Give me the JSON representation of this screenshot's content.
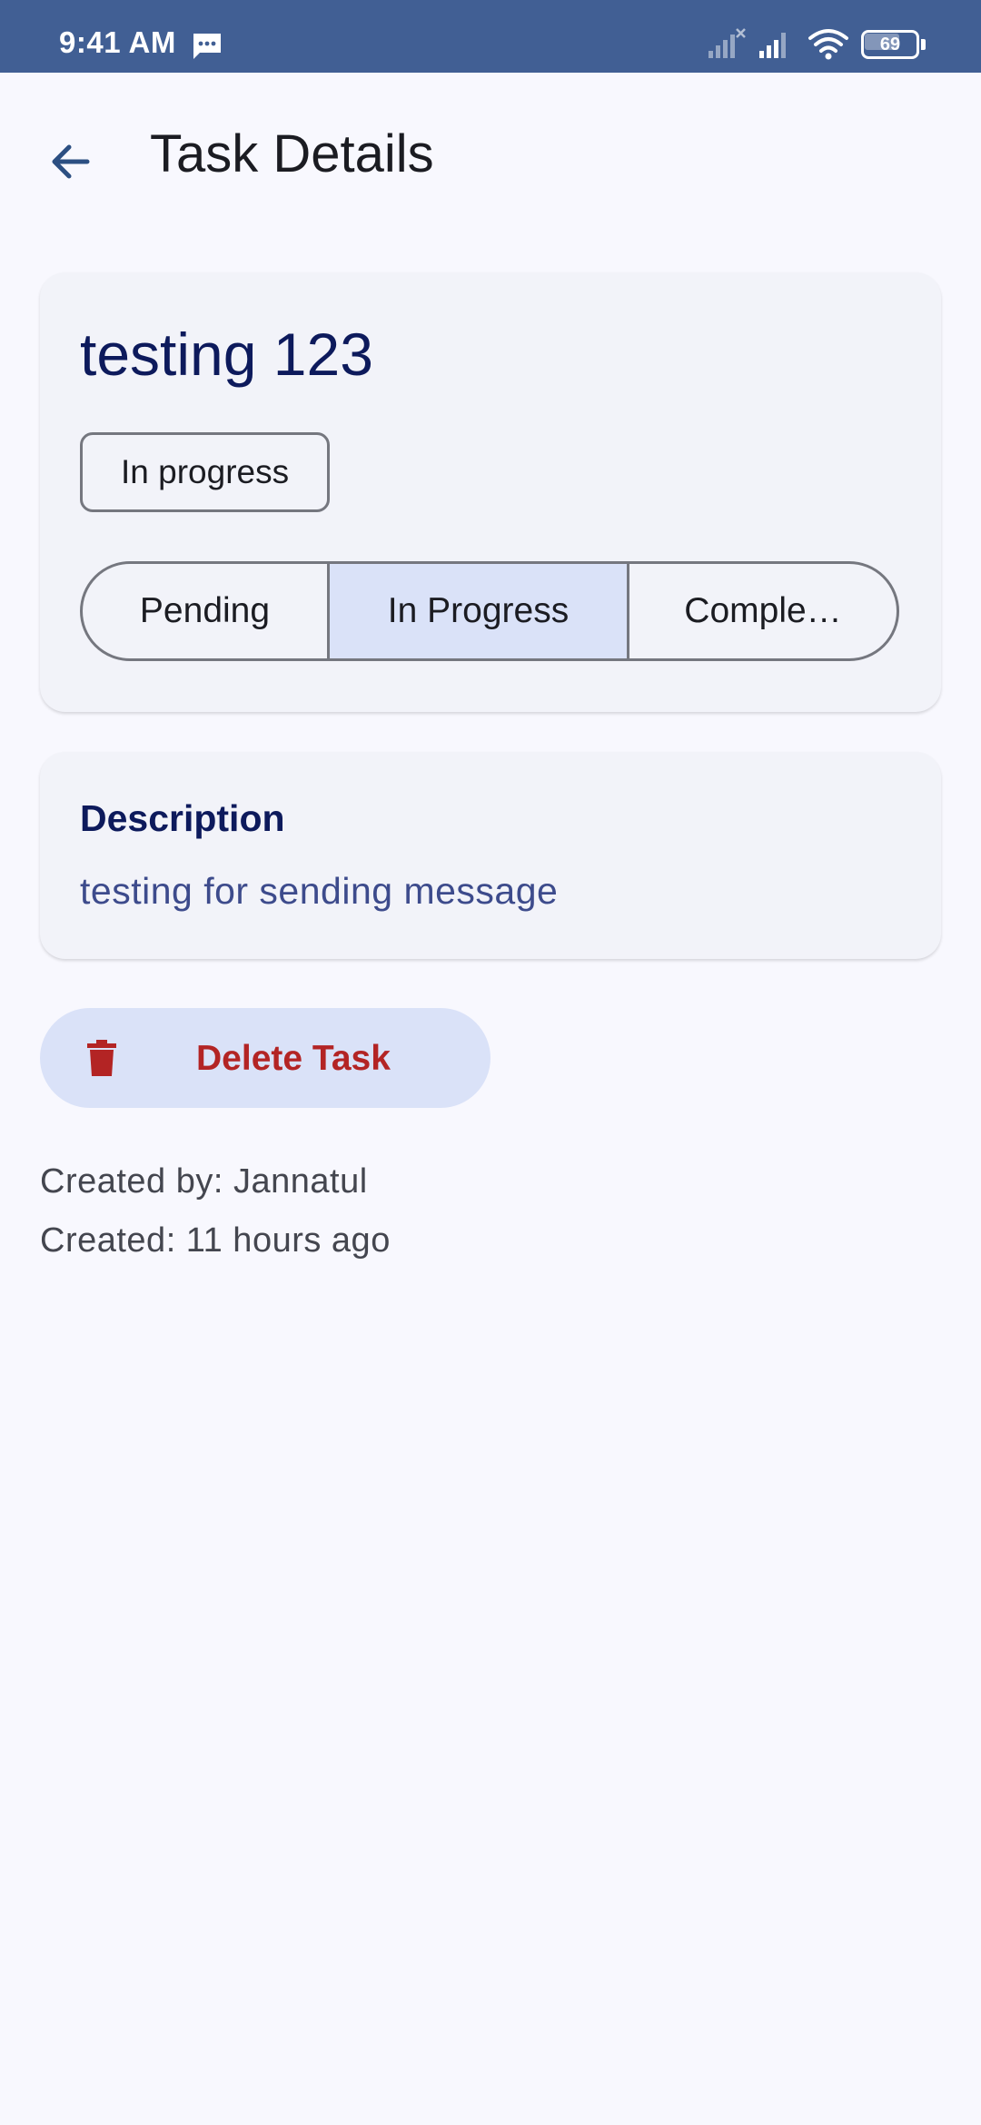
{
  "status_bar": {
    "time": "9:41 AM",
    "battery_level": "69",
    "icons": [
      "message-icon",
      "signal-no-service-icon",
      "signal-icon",
      "wifi-icon",
      "battery-icon"
    ]
  },
  "header": {
    "title": "Task Details",
    "back_icon": "arrow-back-icon"
  },
  "task": {
    "title": "testing 123",
    "status_chip": "In progress",
    "status_options": [
      "Pending",
      "In Progress",
      "Comple…"
    ],
    "selected_status": "In Progress"
  },
  "description": {
    "heading": "Description",
    "body": "testing for sending message"
  },
  "actions": {
    "delete_label": "Delete Task",
    "delete_icon": "trash-icon"
  },
  "meta": {
    "created_by": "Created by: Jannatul",
    "created_at": "Created: 11 hours ago"
  },
  "colors": {
    "status_bar": "#415f94",
    "background": "#f8f8fe",
    "card": "#f2f3f9",
    "title": "#0d1a5c",
    "selected_segment": "#dae2f8",
    "delete_text": "#b32424"
  }
}
